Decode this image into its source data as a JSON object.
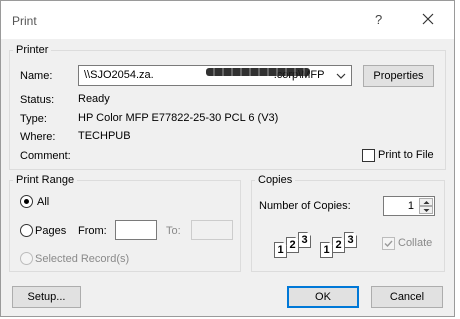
{
  "window": {
    "title": "Print",
    "help_label": "?"
  },
  "printer_group": {
    "legend": "Printer",
    "name_label": "Name:",
    "name_value": "\\\\SJO2054.za.",
    "name_value_suffix": ".corp\\MFPJO0001",
    "properties_label": "Properties",
    "status_label": "Status:",
    "status_value": "Ready",
    "type_label": "Type:",
    "type_value": "HP Color MFP E77822-25-30 PCL 6 (V3)",
    "where_label": "Where:",
    "where_value": "TECHPUB",
    "comment_label": "Comment:",
    "print_to_file_label": "Print to File"
  },
  "print_range": {
    "legend": "Print Range",
    "all_label": "All",
    "pages_label": "Pages",
    "from_label": "From:",
    "to_label": "To:",
    "selected_records_label": "Selected Record(s)"
  },
  "copies": {
    "legend": "Copies",
    "number_label": "Number of Copies:",
    "number_value": "1",
    "collate_label": "Collate",
    "page_numbers": [
      "1",
      "2",
      "3"
    ]
  },
  "buttons": {
    "setup_label": "Setup...",
    "ok_label": "OK",
    "cancel_label": "Cancel"
  },
  "colors": {
    "accent": "#0078d7",
    "dialog_bg": "#f0f0f0",
    "button_bg": "#e1e1e1"
  }
}
